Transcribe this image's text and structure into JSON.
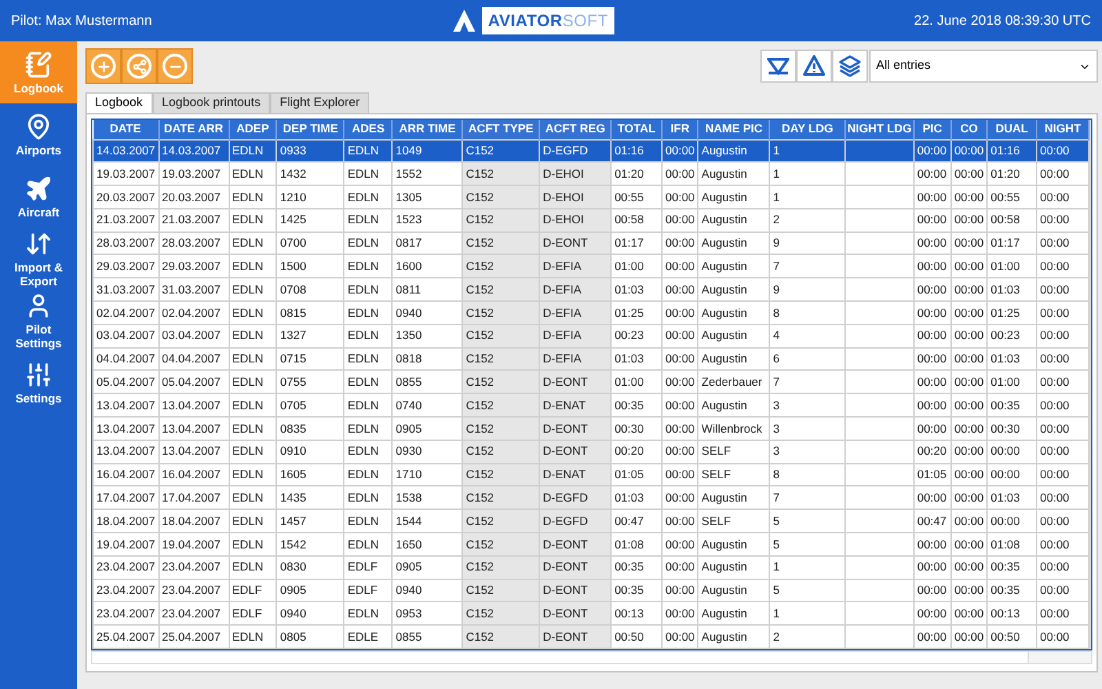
{
  "top_bar": {
    "pilot": "Pilot: Max Mustermann",
    "brand_primary": "AVIATOR",
    "brand_secondary": "SOFT",
    "datetime": "22. June 2018 08:39:30 UTC"
  },
  "sidebar": {
    "items": [
      {
        "kind": "logbook",
        "label": "Logbook",
        "selected": true
      },
      {
        "kind": "airports",
        "label": "Airports",
        "selected": false
      },
      {
        "kind": "aircraft",
        "label": "Aircraft",
        "selected": false
      },
      {
        "kind": "import_export",
        "label": "Import & Export",
        "selected": false
      },
      {
        "kind": "pilot",
        "label": "Pilot Settings",
        "selected": false
      },
      {
        "kind": "settings",
        "label": "Settings",
        "selected": false
      }
    ]
  },
  "toolbar": {
    "filter": {
      "value": "All entries"
    }
  },
  "tabs": [
    {
      "label": "Logbook",
      "selected": true
    },
    {
      "label": "Logbook printouts",
      "selected": false
    },
    {
      "label": "Flight Explorer",
      "selected": false
    }
  ],
  "table": {
    "columns": [
      {
        "label": "DATE",
        "shaded": false
      },
      {
        "label": "DATE ARR",
        "shaded": false
      },
      {
        "label": "ADEP",
        "shaded": false
      },
      {
        "label": "DEP TIME",
        "shaded": false
      },
      {
        "label": "ADES",
        "shaded": false
      },
      {
        "label": "ARR TIME",
        "shaded": false
      },
      {
        "label": "ACFT TYPE",
        "shaded": true
      },
      {
        "label": "ACFT REG",
        "shaded": true
      },
      {
        "label": "TOTAL",
        "shaded": false
      },
      {
        "label": "IFR",
        "shaded": false
      },
      {
        "label": "NAME PIC",
        "shaded": false
      },
      {
        "label": "DAY LDG",
        "shaded": false
      },
      {
        "label": "NIGHT LDG",
        "shaded": false
      },
      {
        "label": "PIC",
        "shaded": false
      },
      {
        "label": "CO",
        "shaded": false
      },
      {
        "label": "DUAL",
        "shaded": false
      },
      {
        "label": "NIGHT",
        "shaded": false
      }
    ],
    "rows": [
      {
        "selected": true,
        "cells": [
          "14.03.2007",
          "14.03.2007",
          "EDLN",
          "0933",
          "EDLN",
          "1049",
          "C152",
          "D-EGFD",
          "01:16",
          "00:00",
          "Augustin",
          "1",
          "",
          "00:00",
          "00:00",
          "01:16",
          "00:00"
        ]
      },
      {
        "selected": false,
        "cells": [
          "19.03.2007",
          "19.03.2007",
          "EDLN",
          "1432",
          "EDLN",
          "1552",
          "C152",
          "D-EHOI",
          "01:20",
          "00:00",
          "Augustin",
          "1",
          "",
          "00:00",
          "00:00",
          "01:20",
          "00:00"
        ]
      },
      {
        "selected": false,
        "cells": [
          "20.03.2007",
          "20.03.2007",
          "EDLN",
          "1210",
          "EDLN",
          "1305",
          "C152",
          "D-EHOI",
          "00:55",
          "00:00",
          "Augustin",
          "1",
          "",
          "00:00",
          "00:00",
          "00:55",
          "00:00"
        ]
      },
      {
        "selected": false,
        "cells": [
          "21.03.2007",
          "21.03.2007",
          "EDLN",
          "1425",
          "EDLN",
          "1523",
          "C152",
          "D-EHOI",
          "00:58",
          "00:00",
          "Augustin",
          "2",
          "",
          "00:00",
          "00:00",
          "00:58",
          "00:00"
        ]
      },
      {
        "selected": false,
        "cells": [
          "28.03.2007",
          "28.03.2007",
          "EDLN",
          "0700",
          "EDLN",
          "0817",
          "C152",
          "D-EONT",
          "01:17",
          "00:00",
          "Augustin",
          "9",
          "",
          "00:00",
          "00:00",
          "01:17",
          "00:00"
        ]
      },
      {
        "selected": false,
        "cells": [
          "29.03.2007",
          "29.03.2007",
          "EDLN",
          "1500",
          "EDLN",
          "1600",
          "C152",
          "D-EFIA",
          "01:00",
          "00:00",
          "Augustin",
          "7",
          "",
          "00:00",
          "00:00",
          "01:00",
          "00:00"
        ]
      },
      {
        "selected": false,
        "cells": [
          "31.03.2007",
          "31.03.2007",
          "EDLN",
          "0708",
          "EDLN",
          "0811",
          "C152",
          "D-EFIA",
          "01:03",
          "00:00",
          "Augustin",
          "9",
          "",
          "00:00",
          "00:00",
          "01:03",
          "00:00"
        ]
      },
      {
        "selected": false,
        "cells": [
          "02.04.2007",
          "02.04.2007",
          "EDLN",
          "0815",
          "EDLN",
          "0940",
          "C152",
          "D-EFIA",
          "01:25",
          "00:00",
          "Augustin",
          "8",
          "",
          "00:00",
          "00:00",
          "01:25",
          "00:00"
        ]
      },
      {
        "selected": false,
        "cells": [
          "03.04.2007",
          "03.04.2007",
          "EDLN",
          "1327",
          "EDLN",
          "1350",
          "C152",
          "D-EFIA",
          "00:23",
          "00:00",
          "Augustin",
          "4",
          "",
          "00:00",
          "00:00",
          "00:23",
          "00:00"
        ]
      },
      {
        "selected": false,
        "cells": [
          "04.04.2007",
          "04.04.2007",
          "EDLN",
          "0715",
          "EDLN",
          "0818",
          "C152",
          "D-EFIA",
          "01:03",
          "00:00",
          "Augustin",
          "6",
          "",
          "00:00",
          "00:00",
          "01:03",
          "00:00"
        ]
      },
      {
        "selected": false,
        "cells": [
          "05.04.2007",
          "05.04.2007",
          "EDLN",
          "0755",
          "EDLN",
          "0855",
          "C152",
          "D-EONT",
          "01:00",
          "00:00",
          "Zederbauer",
          "7",
          "",
          "00:00",
          "00:00",
          "01:00",
          "00:00"
        ]
      },
      {
        "selected": false,
        "cells": [
          "13.04.2007",
          "13.04.2007",
          "EDLN",
          "0705",
          "EDLN",
          "0740",
          "C152",
          "D-ENAT",
          "00:35",
          "00:00",
          "Augustin",
          "3",
          "",
          "00:00",
          "00:00",
          "00:35",
          "00:00"
        ]
      },
      {
        "selected": false,
        "cells": [
          "13.04.2007",
          "13.04.2007",
          "EDLN",
          "0835",
          "EDLN",
          "0905",
          "C152",
          "D-EONT",
          "00:30",
          "00:00",
          "Willenbrock",
          "3",
          "",
          "00:00",
          "00:00",
          "00:30",
          "00:00"
        ]
      },
      {
        "selected": false,
        "cells": [
          "13.04.2007",
          "13.04.2007",
          "EDLN",
          "0910",
          "EDLN",
          "0930",
          "C152",
          "D-EONT",
          "00:20",
          "00:00",
          "SELF",
          "3",
          "",
          "00:20",
          "00:00",
          "00:00",
          "00:00"
        ]
      },
      {
        "selected": false,
        "cells": [
          "16.04.2007",
          "16.04.2007",
          "EDLN",
          "1605",
          "EDLN",
          "1710",
          "C152",
          "D-ENAT",
          "01:05",
          "00:00",
          "SELF",
          "8",
          "",
          "01:05",
          "00:00",
          "00:00",
          "00:00"
        ]
      },
      {
        "selected": false,
        "cells": [
          "17.04.2007",
          "17.04.2007",
          "EDLN",
          "1435",
          "EDLN",
          "1538",
          "C152",
          "D-EGFD",
          "01:03",
          "00:00",
          "Augustin",
          "7",
          "",
          "00:00",
          "00:00",
          "01:03",
          "00:00"
        ]
      },
      {
        "selected": false,
        "cells": [
          "18.04.2007",
          "18.04.2007",
          "EDLN",
          "1457",
          "EDLN",
          "1544",
          "C152",
          "D-EGFD",
          "00:47",
          "00:00",
          "SELF",
          "5",
          "",
          "00:47",
          "00:00",
          "00:00",
          "00:00"
        ]
      },
      {
        "selected": false,
        "cells": [
          "19.04.2007",
          "19.04.2007",
          "EDLN",
          "1542",
          "EDLN",
          "1650",
          "C152",
          "D-EONT",
          "01:08",
          "00:00",
          "Augustin",
          "5",
          "",
          "00:00",
          "00:00",
          "01:08",
          "00:00"
        ]
      },
      {
        "selected": false,
        "cells": [
          "23.04.2007",
          "23.04.2007",
          "EDLN",
          "0830",
          "EDLF",
          "0905",
          "C152",
          "D-EONT",
          "00:35",
          "00:00",
          "Augustin",
          "1",
          "",
          "00:00",
          "00:00",
          "00:35",
          "00:00"
        ]
      },
      {
        "selected": false,
        "cells": [
          "23.04.2007",
          "23.04.2007",
          "EDLF",
          "0905",
          "EDLF",
          "0940",
          "C152",
          "D-EONT",
          "00:35",
          "00:00",
          "Augustin",
          "5",
          "",
          "00:00",
          "00:00",
          "00:35",
          "00:00"
        ]
      },
      {
        "selected": false,
        "cells": [
          "23.04.2007",
          "23.04.2007",
          "EDLF",
          "0940",
          "EDLN",
          "0953",
          "C152",
          "D-EONT",
          "00:13",
          "00:00",
          "Augustin",
          "1",
          "",
          "00:00",
          "00:00",
          "00:13",
          "00:00"
        ]
      },
      {
        "selected": false,
        "cells": [
          "25.04.2007",
          "25.04.2007",
          "EDLN",
          "0805",
          "EDLE",
          "0855",
          "C152",
          "D-EONT",
          "00:50",
          "00:00",
          "Augustin",
          "2",
          "",
          "00:00",
          "00:00",
          "00:50",
          "00:00"
        ]
      }
    ]
  }
}
